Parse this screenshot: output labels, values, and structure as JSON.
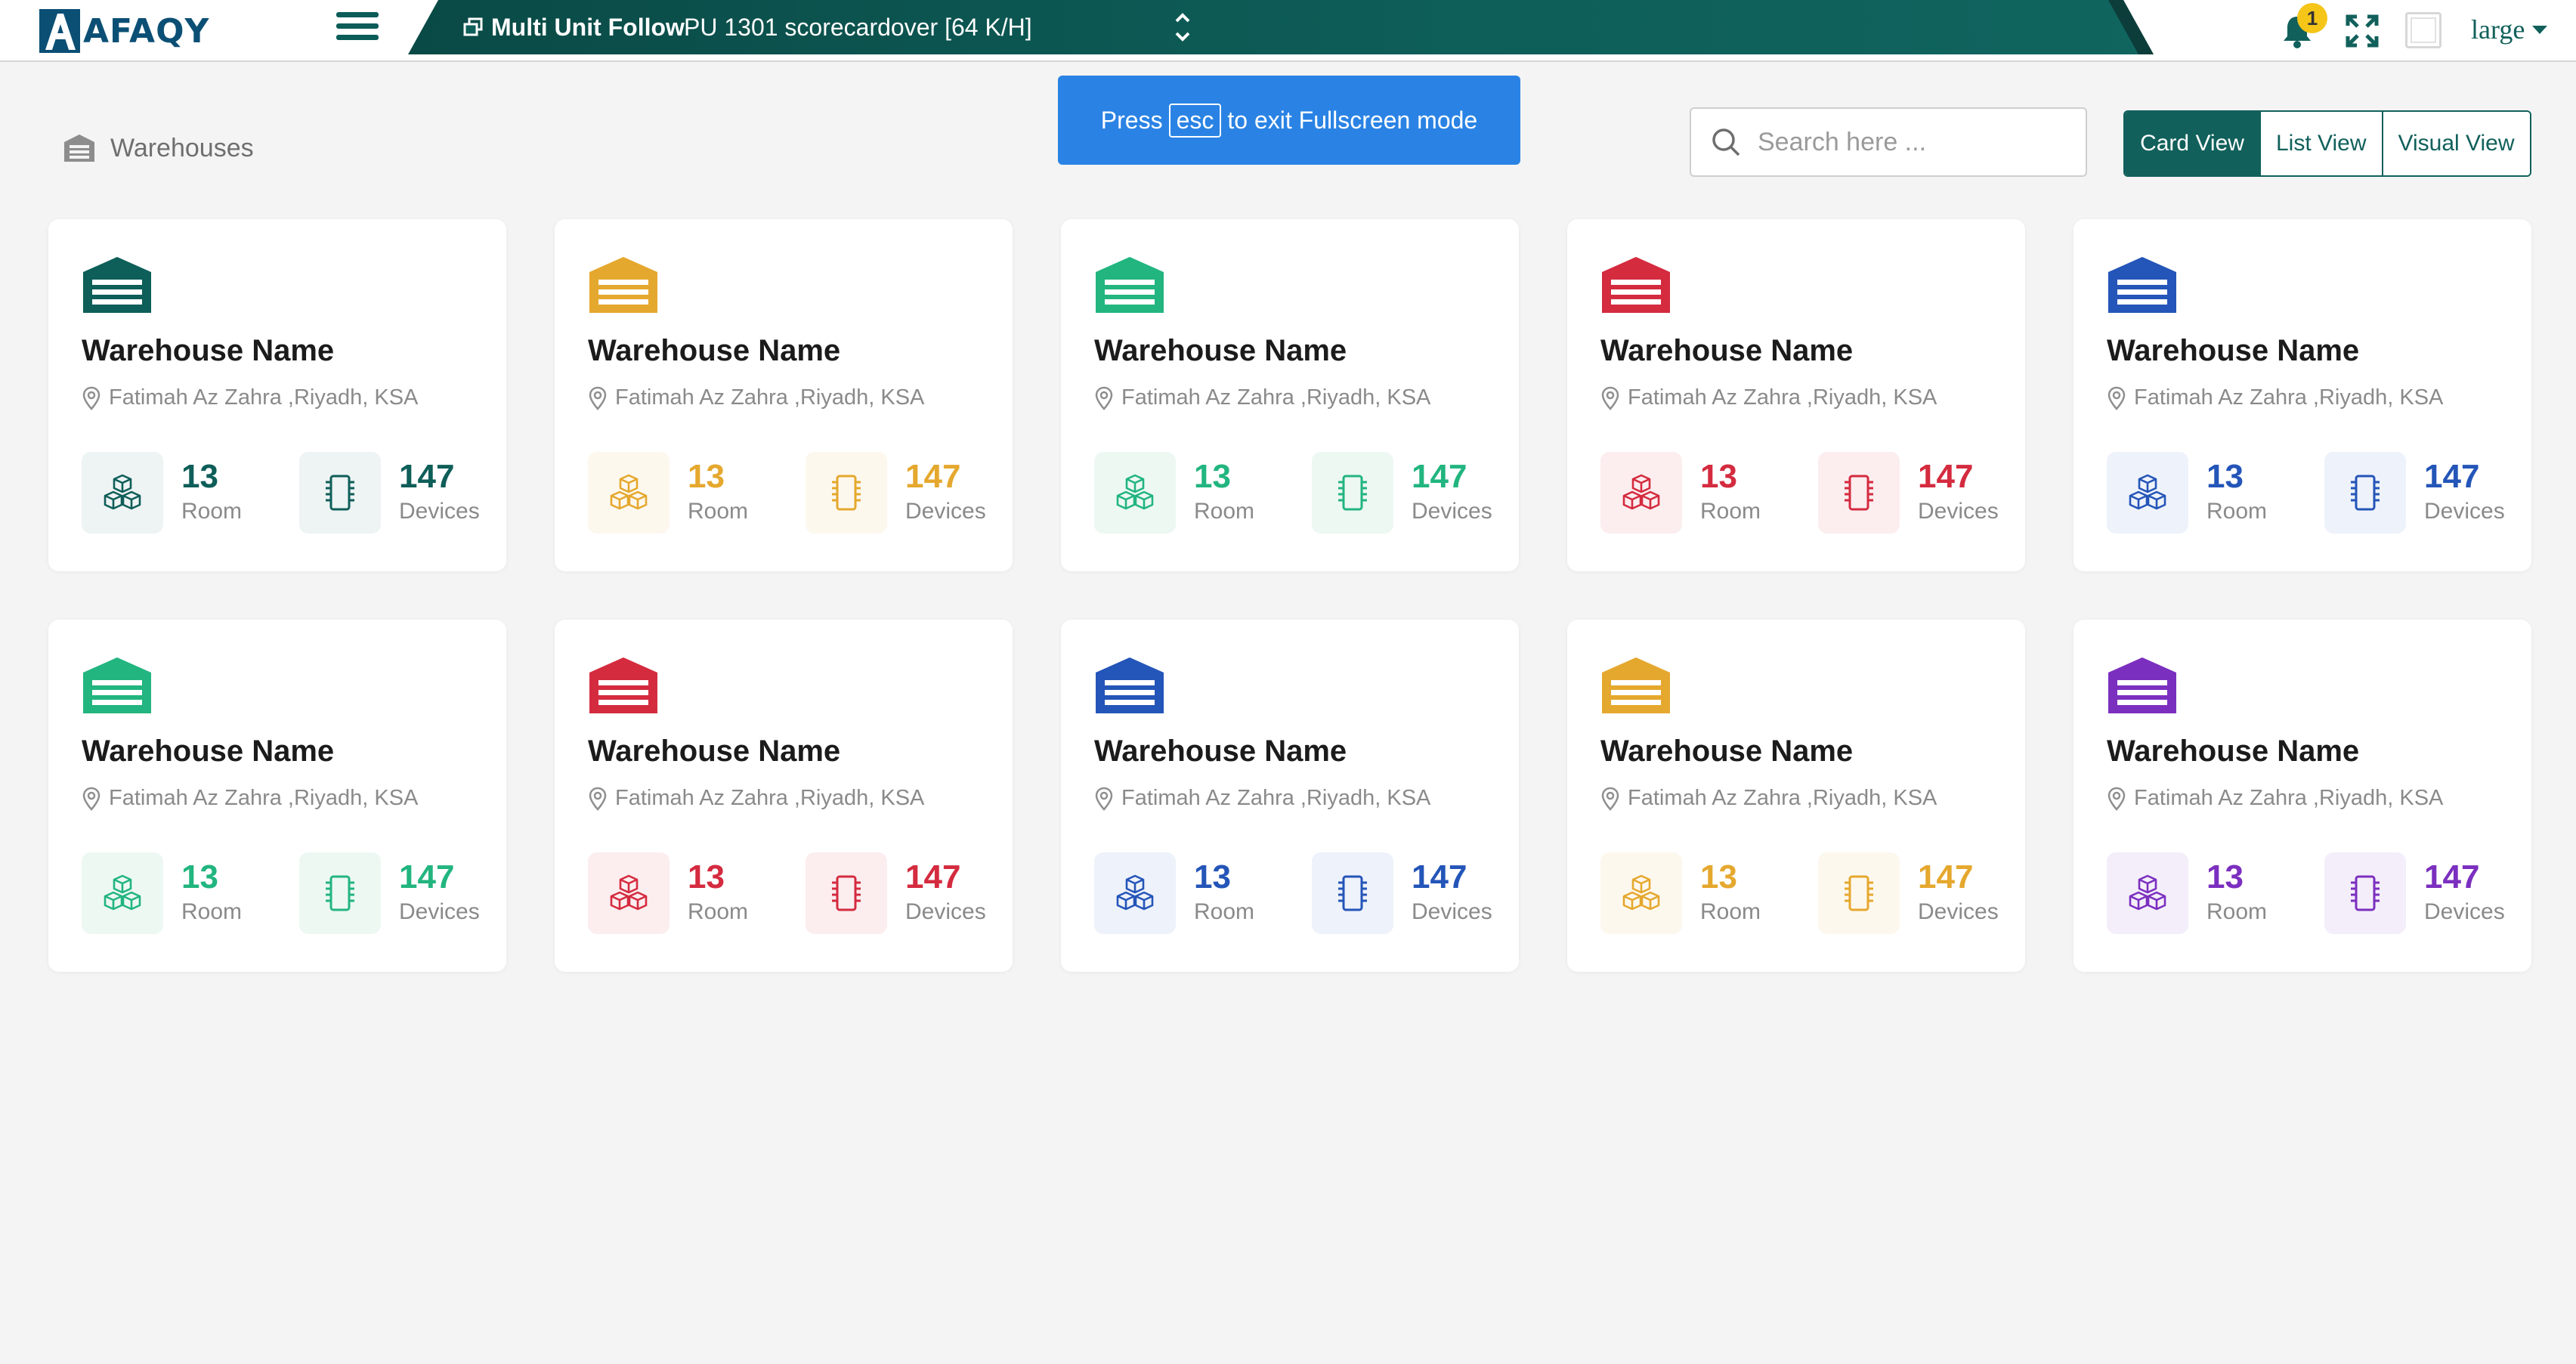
{
  "header": {
    "logo_text": "AFAQY",
    "multi_unit_label": "Multi Unit Follow",
    "unit_selected": "PU 1301 scorecardover [64 K/H]",
    "notification_count": "1",
    "size_selected": "large"
  },
  "breadcrumb": {
    "label": "Warehouses"
  },
  "fullscreen_toast": {
    "prefix": "Press",
    "key": "esc",
    "suffix": "to exit Fullscreen mode"
  },
  "search": {
    "placeholder": "Search here ..."
  },
  "views": [
    {
      "label": "Card View",
      "active": true
    },
    {
      "label": "List View",
      "active": false
    },
    {
      "label": "Visual View",
      "active": false
    }
  ],
  "cards": [
    {
      "name": "Warehouse Name",
      "address": "Fatimah Az Zahra ,Riyadh, KSA",
      "rooms": "13",
      "room_label": "Room",
      "devices": "147",
      "devices_label": "Devices",
      "color": "#0e5e59",
      "tint": "#eef3f3"
    },
    {
      "name": "Warehouse Name",
      "address": "Fatimah Az Zahra ,Riyadh, KSA",
      "rooms": "13",
      "room_label": "Room",
      "devices": "147",
      "devices_label": "Devices",
      "color": "#e5a82e",
      "tint": "#fdf8ee"
    },
    {
      "name": "Warehouse Name",
      "address": "Fatimah Az Zahra ,Riyadh, KSA",
      "rooms": "13",
      "room_label": "Room",
      "devices": "147",
      "devices_label": "Devices",
      "color": "#22b57f",
      "tint": "#edf8f3"
    },
    {
      "name": "Warehouse Name",
      "address": "Fatimah Az Zahra ,Riyadh, KSA",
      "rooms": "13",
      "room_label": "Room",
      "devices": "147",
      "devices_label": "Devices",
      "color": "#d42b3f",
      "tint": "#fcedef"
    },
    {
      "name": "Warehouse Name",
      "address": "Fatimah Az Zahra ,Riyadh, KSA",
      "rooms": "13",
      "room_label": "Room",
      "devices": "147",
      "devices_label": "Devices",
      "color": "#2455b8",
      "tint": "#eef2fa"
    },
    {
      "name": "Warehouse Name",
      "address": "Fatimah Az Zahra ,Riyadh, KSA",
      "rooms": "13",
      "room_label": "Room",
      "devices": "147",
      "devices_label": "Devices",
      "color": "#22b57f",
      "tint": "#edf8f3"
    },
    {
      "name": "Warehouse Name",
      "address": "Fatimah Az Zahra ,Riyadh, KSA",
      "rooms": "13",
      "room_label": "Room",
      "devices": "147",
      "devices_label": "Devices",
      "color": "#d42b3f",
      "tint": "#fcedef"
    },
    {
      "name": "Warehouse Name",
      "address": "Fatimah Az Zahra ,Riyadh, KSA",
      "rooms": "13",
      "room_label": "Room",
      "devices": "147",
      "devices_label": "Devices",
      "color": "#2455b8",
      "tint": "#eef2fa"
    },
    {
      "name": "Warehouse Name",
      "address": "Fatimah Az Zahra ,Riyadh, KSA",
      "rooms": "13",
      "room_label": "Room",
      "devices": "147",
      "devices_label": "Devices",
      "color": "#e5a82e",
      "tint": "#fdf8ee"
    },
    {
      "name": "Warehouse Name",
      "address": "Fatimah Az Zahra ,Riyadh, KSA",
      "rooms": "13",
      "room_label": "Room",
      "devices": "147",
      "devices_label": "Devices",
      "color": "#7b2fbf",
      "tint": "#f4eefa"
    }
  ]
}
